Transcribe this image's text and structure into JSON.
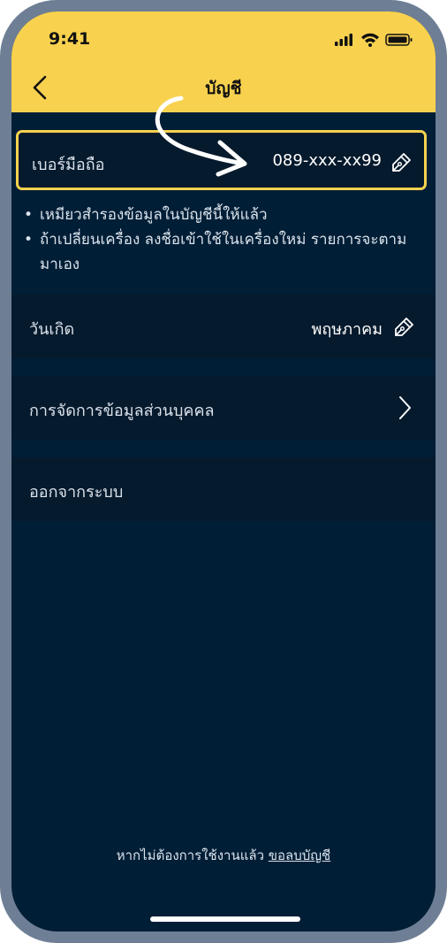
{
  "status_bar": {
    "time": "9:41"
  },
  "header": {
    "title": "บัญชี"
  },
  "phone_row": {
    "label": "เบอร์มือถือ",
    "value": "089-xxx-xx99"
  },
  "notes": [
    "เหมียวสำรองข้อมูลในบัญชีนี้ให้แล้ว",
    "ถ้าเปลี่ยนเครื่อง ลงชื่อเข้าใช้ในเครื่องใหม่ รายการจะตามมาเอง"
  ],
  "birthday_row": {
    "label": "วันเกิด",
    "value": "พฤษภาคม"
  },
  "privacy_row": {
    "label": "การจัดการข้อมูลส่วนบุคคล"
  },
  "logout_row": {
    "label": "ออกจากระบบ"
  },
  "footer": {
    "text": "หากไม่ต้องการใช้งานแล้ว",
    "link": "ขอลบบัญชี"
  },
  "colors": {
    "accent": "#f8d24f",
    "background": "#001e36",
    "row": "#061a2d"
  }
}
